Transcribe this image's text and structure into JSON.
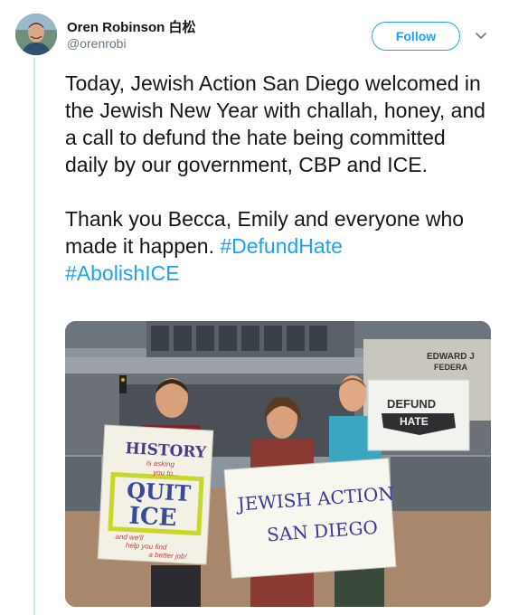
{
  "tweet": {
    "author_name": "Oren Robinson 白松",
    "handle": "@orenrobi",
    "follow_label": "Follow",
    "text_paragraph_1": "Today, Jewish Action San Diego welcomed in the Jewish New Year with challah, honey, and a call to defund the hate being committed daily by our government, CBP and ICE.",
    "text_paragraph_2": "Thank you Becca, Emily and everyone who made it happen.",
    "hashtag_1": "#DefundHate",
    "hashtag_2": "#AbolishICE"
  },
  "photo": {
    "building_sign_line1": "EDWARD J",
    "building_sign_line2": "FEDERA",
    "sign_left_line1": "HISTORY",
    "sign_left_line2": "is asking",
    "sign_left_line3": "you to...",
    "sign_left_line4": "QUIT",
    "sign_left_line5": "ICE",
    "sign_left_line6": "and we'll",
    "sign_left_line7": "help you find",
    "sign_left_line8": "a better job!",
    "sign_center_line1": "JEWISH ACTION",
    "sign_center_line2": "SAN DIEGO",
    "sign_right_line1": "DEFUND",
    "sign_right_line2": "HATE"
  },
  "colors": {
    "accent": "#1da1f2",
    "thread_line": "#cce4f6",
    "text": "#14171a",
    "muted": "#657786"
  },
  "icons": {
    "avatar": "avatar",
    "more": "chevron-down-icon"
  }
}
